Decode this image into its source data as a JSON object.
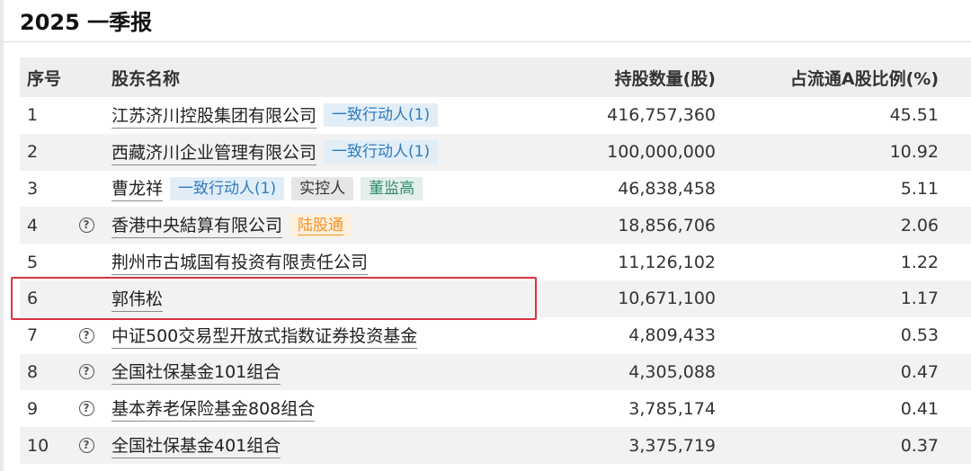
{
  "title": "2025 一季报",
  "columns": {
    "index": "序号",
    "name": "股东名称",
    "shares": "持股数量(股)",
    "ratio": "占流通A股比例(%)"
  },
  "rows": [
    {
      "index": "1",
      "name": "江苏济川控股集团有限公司",
      "tags": [
        "一致行动人(1)"
      ],
      "shares": "416,757,360",
      "ratio": "45.51"
    },
    {
      "index": "2",
      "name": "西藏济川企业管理有限公司",
      "tags": [
        "一致行动人(1)"
      ],
      "shares": "100,000,000",
      "ratio": "10.92"
    },
    {
      "index": "3",
      "name": "曹龙祥",
      "tags": [
        "一致行动人(1)",
        "实控人",
        "董监高"
      ],
      "shares": "46,838,458",
      "ratio": "5.11"
    },
    {
      "index": "4",
      "name": "香港中央結算有限公司",
      "tags": [
        "陆股通"
      ],
      "shares": "18,856,706",
      "ratio": "2.06",
      "help": "?"
    },
    {
      "index": "5",
      "name": "荆州市古城国有投资有限责任公司",
      "tags": [],
      "shares": "11,126,102",
      "ratio": "1.22"
    },
    {
      "index": "6",
      "name": "郭伟松",
      "tags": [],
      "shares": "10,671,100",
      "ratio": "1.17"
    },
    {
      "index": "7",
      "name": "中证500交易型开放式指数证券投资基金",
      "tags": [],
      "shares": "4,809,433",
      "ratio": "0.53",
      "help": "?"
    },
    {
      "index": "8",
      "name": "全国社保基金101组合",
      "tags": [],
      "shares": "4,305,088",
      "ratio": "0.47",
      "help": "?"
    },
    {
      "index": "9",
      "name": "基本养老保险基金808组合",
      "tags": [],
      "shares": "3,785,174",
      "ratio": "0.41",
      "help": "?"
    },
    {
      "index": "10",
      "name": "全国社保基金401组合",
      "tags": [],
      "shares": "3,375,719",
      "ratio": "0.37",
      "help": "?"
    }
  ],
  "colors": {
    "highlight_border": "#d9343e",
    "concert_tag": "#2d7bbf",
    "hk_connect_tag": "#f39221",
    "board_tag": "#2f8b6a"
  }
}
